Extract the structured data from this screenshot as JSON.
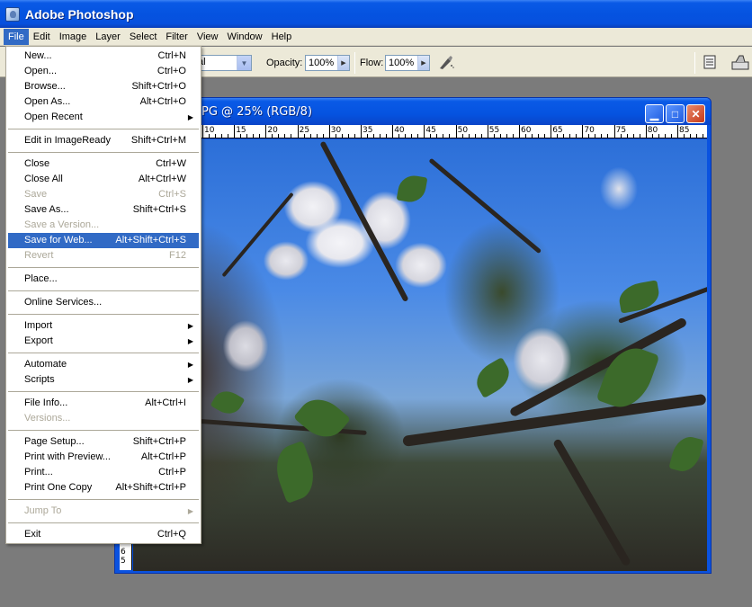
{
  "app": {
    "title": "Adobe Photoshop"
  },
  "menubar": {
    "items": [
      "File",
      "Edit",
      "Image",
      "Layer",
      "Select",
      "Filter",
      "View",
      "Window",
      "Help"
    ],
    "active": "File"
  },
  "options": {
    "mode_value": "al",
    "opacity_label": "Opacity:",
    "opacity_value": "100%",
    "flow_label": "Flow:",
    "flow_value": "100%"
  },
  "document": {
    "title": "PG @ 25% (RGB/8)",
    "ruler_top": [
      "10",
      "15",
      "20",
      "25",
      "30",
      "35",
      "40",
      "45",
      "50",
      "55",
      "60",
      "65",
      "70",
      "75",
      "80",
      "85"
    ],
    "ruler_left_digits": [
      "6",
      "5"
    ]
  },
  "file_menu": {
    "groups": [
      [
        {
          "label": "New...",
          "shortcut": "Ctrl+N",
          "disabled": false
        },
        {
          "label": "Open...",
          "shortcut": "Ctrl+O",
          "disabled": false
        },
        {
          "label": "Browse...",
          "shortcut": "Shift+Ctrl+O",
          "disabled": false
        },
        {
          "label": "Open As...",
          "shortcut": "Alt+Ctrl+O",
          "disabled": false
        },
        {
          "label": "Open Recent",
          "shortcut": "",
          "submenu": true,
          "disabled": false
        }
      ],
      [
        {
          "label": "Edit in ImageReady",
          "shortcut": "Shift+Ctrl+M",
          "disabled": false
        }
      ],
      [
        {
          "label": "Close",
          "shortcut": "Ctrl+W",
          "disabled": false
        },
        {
          "label": "Close All",
          "shortcut": "Alt+Ctrl+W",
          "disabled": false
        },
        {
          "label": "Save",
          "shortcut": "Ctrl+S",
          "disabled": true
        },
        {
          "label": "Save As...",
          "shortcut": "Shift+Ctrl+S",
          "disabled": false
        },
        {
          "label": "Save a Version...",
          "shortcut": "",
          "disabled": true
        },
        {
          "label": "Save for Web...",
          "shortcut": "Alt+Shift+Ctrl+S",
          "disabled": false,
          "highlight": true
        },
        {
          "label": "Revert",
          "shortcut": "F12",
          "disabled": true
        }
      ],
      [
        {
          "label": "Place...",
          "shortcut": "",
          "disabled": false
        }
      ],
      [
        {
          "label": "Online Services...",
          "shortcut": "",
          "disabled": false
        }
      ],
      [
        {
          "label": "Import",
          "shortcut": "",
          "submenu": true,
          "disabled": false
        },
        {
          "label": "Export",
          "shortcut": "",
          "submenu": true,
          "disabled": false
        }
      ],
      [
        {
          "label": "Automate",
          "shortcut": "",
          "submenu": true,
          "disabled": false
        },
        {
          "label": "Scripts",
          "shortcut": "",
          "submenu": true,
          "disabled": false
        }
      ],
      [
        {
          "label": "File Info...",
          "shortcut": "Alt+Ctrl+I",
          "disabled": false
        },
        {
          "label": "Versions...",
          "shortcut": "",
          "disabled": true
        }
      ],
      [
        {
          "label": "Page Setup...",
          "shortcut": "Shift+Ctrl+P",
          "disabled": false
        },
        {
          "label": "Print with Preview...",
          "shortcut": "Alt+Ctrl+P",
          "disabled": false
        },
        {
          "label": "Print...",
          "shortcut": "Ctrl+P",
          "disabled": false
        },
        {
          "label": "Print One Copy",
          "shortcut": "Alt+Shift+Ctrl+P",
          "disabled": false
        }
      ],
      [
        {
          "label": "Jump To",
          "shortcut": "",
          "submenu": true,
          "disabled": true
        }
      ],
      [
        {
          "label": "Exit",
          "shortcut": "Ctrl+Q",
          "disabled": false
        }
      ]
    ]
  },
  "colors": {
    "titlebar": "#0553e0",
    "menu_highlight": "#316ac5",
    "chrome": "#ece9d8",
    "workspace": "#7b7b7b"
  },
  "icons": {
    "app": "photoshop-eye-icon",
    "airbrush": "airbrush-icon",
    "palette": "palette-well-icon",
    "toolpreset": "brush-preset-icon"
  }
}
